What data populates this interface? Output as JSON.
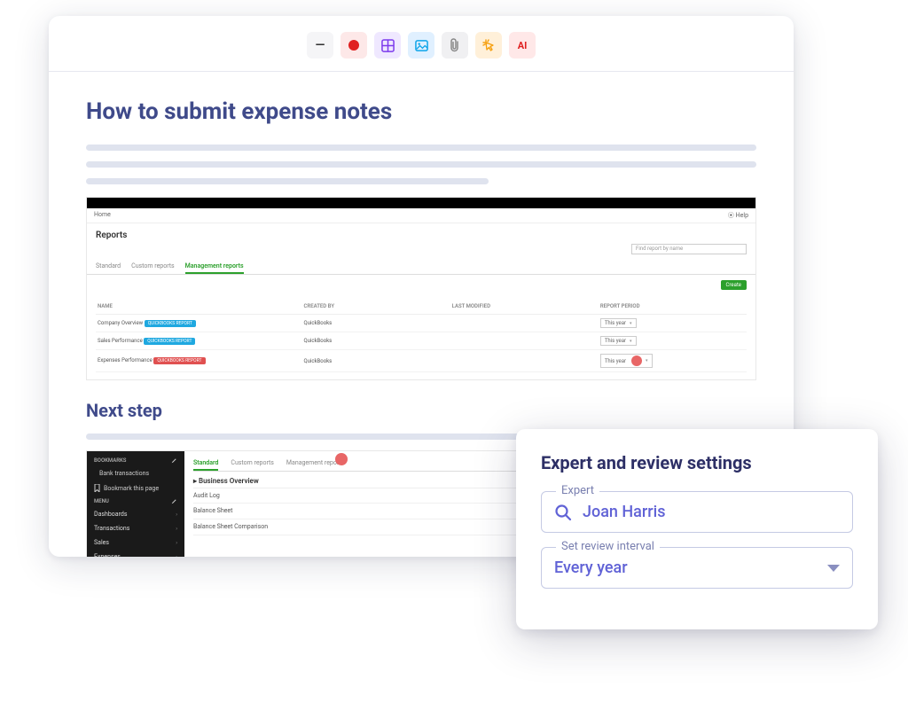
{
  "toolbar": {
    "ai_label": "AI"
  },
  "page": {
    "title": "How to submit expense notes",
    "next_step_heading": "Next step"
  },
  "embed1": {
    "home": "Home",
    "help": "Help",
    "title": "Reports",
    "search_placeholder": "Find report by name",
    "tabs": [
      "Standard",
      "Custom reports",
      "Management reports"
    ],
    "active_tab": "Management reports",
    "create_btn": "Create",
    "columns": [
      "NAME",
      "CREATED BY",
      "LAST MODIFIED",
      "REPORT PERIOD"
    ],
    "rows": [
      {
        "name": "Company Overview",
        "badge": "QUICKBOOKS REPORT",
        "created_by": "QuickBooks",
        "period": "This year"
      },
      {
        "name": "Sales Performance",
        "badge": "QUICKBOOKS REPORT",
        "created_by": "QuickBooks",
        "period": "This year"
      },
      {
        "name": "Expenses Performance",
        "badge": "QUICKBOOKS REPORT",
        "created_by": "QuickBooks",
        "period": "This year"
      }
    ]
  },
  "embed2": {
    "sidebar": {
      "bookmarks_head": "BOOKMARKS",
      "bank_transactions": "Bank transactions",
      "bookmark_this": "Bookmark this page",
      "menu_head": "MENU",
      "items": [
        "Dashboards",
        "Transactions",
        "Sales",
        "Expenses"
      ]
    },
    "tabs": [
      "Standard",
      "Custom reports",
      "Management reports"
    ],
    "category": "Business Overview",
    "rows": [
      {
        "label": "Audit Log",
        "starred": false
      },
      {
        "label": "Balance Sheet",
        "starred": true
      },
      {
        "label": "Balance Sheet Comparison",
        "starred": false
      }
    ]
  },
  "settings": {
    "title": "Expert and review settings",
    "expert_label": "Expert",
    "expert_value": "Joan Harris",
    "interval_label": "Set review interval",
    "interval_value": "Every year"
  }
}
